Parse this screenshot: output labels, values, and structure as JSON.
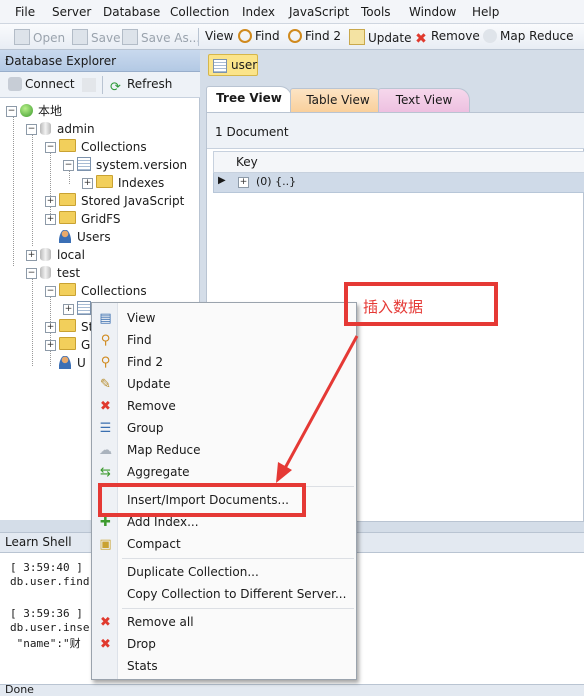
{
  "menubar": [
    "File",
    "Server",
    "Database",
    "Collection",
    "Index",
    "JavaScript",
    "Tools",
    "Window",
    "Help"
  ],
  "toolbar": {
    "open": "Open",
    "save": "Save",
    "save_as": "Save As...",
    "view": "View",
    "find": "Find",
    "find2": "Find 2",
    "update": "Update",
    "remove": "Remove",
    "map_reduce": "Map Reduce"
  },
  "explorer": {
    "title": "Database Explorer",
    "pin": "⭎",
    "connect": "Connect",
    "refresh": "Refresh"
  },
  "tree": {
    "root": "本地",
    "admin": "admin",
    "collections": "Collections",
    "system_version": "system.version",
    "indexes": "Indexes",
    "stored_js": "Stored JavaScript",
    "gridfs": "GridFS",
    "users": "Users",
    "local": "local",
    "test": "test",
    "test_collections": "Collections",
    "partial_st": "St",
    "partial_g": "G",
    "partial_u": "U"
  },
  "doc_tab": "user",
  "view_tabs": [
    "Tree View",
    "Table View",
    "Text View"
  ],
  "doc_count": "1 Document",
  "grid": {
    "key_header": "Key",
    "row_value": "(0) {..}"
  },
  "shell": {
    "title": "Learn Shell",
    "lines": [
      "[ 3:59:40 ]",
      "db.user.find",
      "",
      "[ 3:59:36 ]",
      "db.user.inse",
      " \"name\":\"财"
    ]
  },
  "status": "Done",
  "context_menu": {
    "items": [
      "View",
      "Find",
      "Find 2",
      "Update",
      "Remove",
      "Group",
      "Map Reduce",
      "Aggregate",
      "Insert/Import Documents...",
      "Add Index...",
      "Compact",
      "Duplicate Collection...",
      "Copy Collection to Different Server...",
      "Remove all",
      "Drop",
      "Stats"
    ]
  },
  "annotation": {
    "text": "插入数据",
    "color": "#e53935"
  }
}
